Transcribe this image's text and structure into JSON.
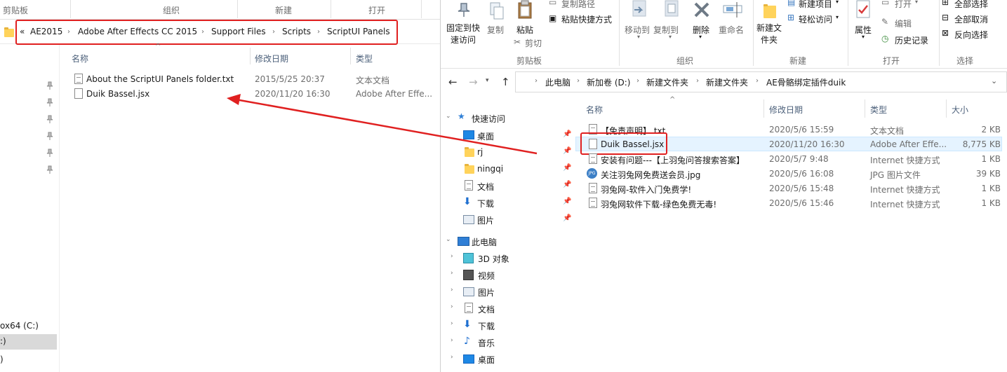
{
  "left": {
    "ribbon_groups": [
      "剪贴板",
      "组织",
      "新建",
      "打开"
    ],
    "breadcrumb_overflow": "«",
    "breadcrumb": [
      "AE2015",
      "Adobe After Effects CC 2015",
      "Support Files",
      "Scripts",
      "ScriptUI Panels"
    ],
    "columns": [
      "名称",
      "修改日期",
      "类型"
    ],
    "files": [
      {
        "name": "About the ScriptUI Panels folder.txt",
        "date": "2015/5/25 20:37",
        "type": "文本文档"
      },
      {
        "name": "Duik Bassel.jsx",
        "date": "2020/11/20 16:30",
        "type": "Adobe After Effe..."
      }
    ],
    "nav_drives": [
      "ox64 (C:)",
      ":)",
      ")"
    ]
  },
  "right": {
    "ribbon": {
      "pin_label": "固定到快速访问",
      "copy_label": "复制",
      "paste_label": "粘贴",
      "copy_path_label": "复制路径",
      "paste_shortcut_label": "粘贴快捷方式",
      "cut_label": "剪切",
      "move_to_label": "移动到",
      "copy_to_label": "复制到",
      "delete_label": "删除",
      "rename_label": "重命名",
      "new_folder_label": "新建文件夹",
      "new_item_label": "新建项目",
      "easy_access_label": "轻松访问",
      "properties_label": "属性",
      "open_label": "打开",
      "edit_label": "编辑",
      "history_label": "历史记录",
      "select_all_label": "全部选择",
      "select_none_label": "全部取消",
      "invert_selection_label": "反向选择",
      "group_labels": [
        "剪贴板",
        "组织",
        "新建",
        "打开",
        "选择"
      ]
    },
    "breadcrumb": [
      "此电脑",
      "新加卷 (D:)",
      "新建文件夹",
      "新建文件夹",
      "AE骨骼绑定插件duik"
    ],
    "nav": {
      "quick_access": "快速访问",
      "quick_items": [
        "桌面",
        "rj",
        "ningqi",
        "文档",
        "下载",
        "图片"
      ],
      "this_pc": "此电脑",
      "pc_items": [
        "3D 对象",
        "视频",
        "图片",
        "文档",
        "下载",
        "音乐",
        "桌面"
      ]
    },
    "columns": [
      "名称",
      "修改日期",
      "类型",
      "大小"
    ],
    "files": [
      {
        "name": "【免责声明】.txt",
        "date": "2020/5/6 15:59",
        "type": "文本文档",
        "size": "2 KB"
      },
      {
        "name": "Duik Bassel.jsx",
        "date": "2020/11/20 16:30",
        "type": "Adobe After Effe...",
        "size": "8,775 KB"
      },
      {
        "name": "安装有问题---【上羽兔问答搜索答案】",
        "date": "2020/5/7 9:48",
        "type": "Internet 快捷方式",
        "size": "1 KB"
      },
      {
        "name": "关注羽兔网免费送会员.jpg",
        "date": "2020/5/6 16:08",
        "type": "JPG 图片文件",
        "size": "39 KB"
      },
      {
        "name": "羽兔网-软件入门免费学!",
        "date": "2020/5/6 15:48",
        "type": "Internet 快捷方式",
        "size": "1 KB"
      },
      {
        "name": "羽兔网软件下载-绿色免费无毒!",
        "date": "2020/5/6 15:46",
        "type": "Internet 快捷方式",
        "size": "1 KB"
      }
    ]
  },
  "colors": {
    "highlight_red": "#e02020",
    "selection_blue": "#cce8ff",
    "folder_yellow": "#ffd35b",
    "accent_blue": "#1e88e5"
  }
}
